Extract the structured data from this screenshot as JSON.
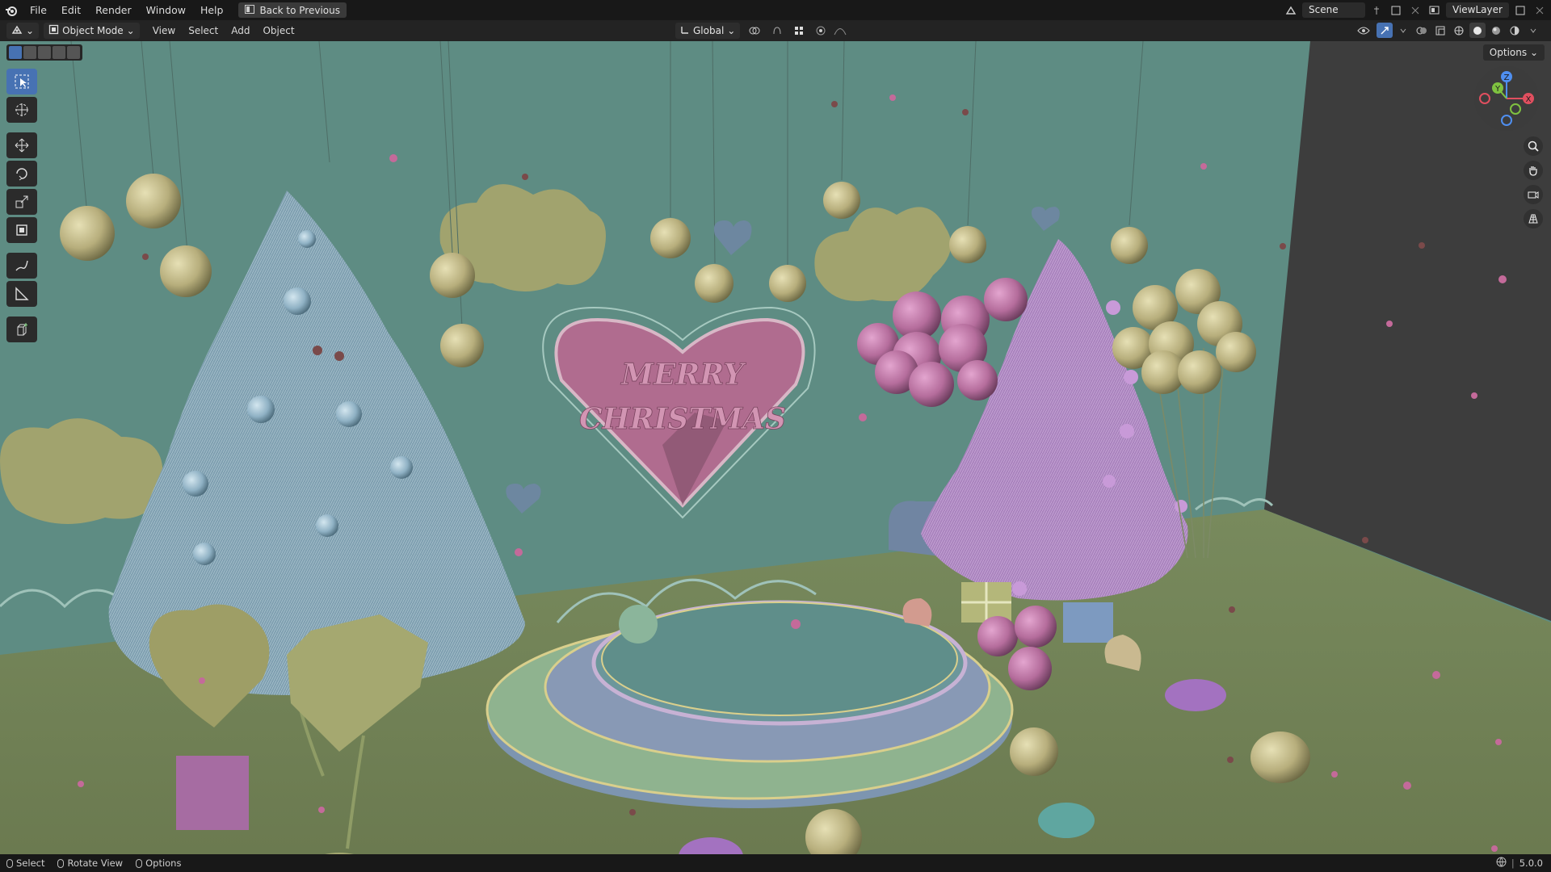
{
  "topbar": {
    "menu": [
      "File",
      "Edit",
      "Render",
      "Window",
      "Help"
    ],
    "back_label": "Back to Previous",
    "scene": "Scene",
    "view_layer": "ViewLayer"
  },
  "header": {
    "mode": "Object Mode",
    "menus": [
      "View",
      "Select",
      "Add",
      "Object"
    ],
    "transform_orientation": "Global",
    "options_label": "Options"
  },
  "viewport": {
    "sign_text": [
      "MERRY",
      "CHRISTMAS"
    ],
    "gizmo_axes": [
      "X",
      "Y",
      "Z"
    ]
  },
  "statusbar": {
    "items": [
      "Select",
      "Rotate View",
      "Options"
    ],
    "version": "5.0.0"
  },
  "colors": {
    "accent": "#4772b3",
    "wall": "#5f8f86",
    "floor": "#6f7f55",
    "tree_blue": "#7f9fb0",
    "tree_purple": "#b18fc4"
  }
}
